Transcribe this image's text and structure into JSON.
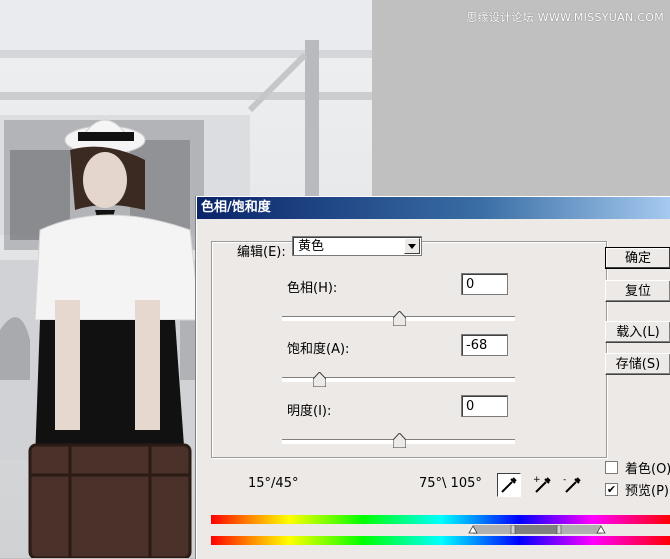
{
  "watermark": "思缘设计论坛  WWW.MISSYUAN.COM",
  "dialog": {
    "title": "色相/饱和度",
    "edit_label": "编辑(E):",
    "edit_value": "黄色",
    "hue": {
      "label": "色相(H):",
      "value": "0",
      "level": 0
    },
    "saturation": {
      "label": "饱和度(A):",
      "value": "-68",
      "level": -68
    },
    "lightness": {
      "label": "明度(I):",
      "value": "0",
      "level": 0
    },
    "range_left": "15°/45°",
    "range_right": "75°\\ 105°",
    "buttons": {
      "ok": "确定",
      "reset": "复位",
      "load": "载入(L)",
      "save": "存储(S)"
    },
    "colorize": {
      "label": "着色(O)",
      "checked": false
    },
    "preview": {
      "label": "预览(P)",
      "checked": true
    }
  },
  "colors": {
    "title_start": "#0a246a",
    "title_end": "#a6caf0",
    "dialog_bg": "#ece9e6",
    "canvas_bg": "#c0c0c0"
  },
  "icons": [
    "eyedropper-icon",
    "eyedropper-plus-icon",
    "eyedropper-minus-icon",
    "dropdown-arrow-icon",
    "checkmark-icon"
  ]
}
